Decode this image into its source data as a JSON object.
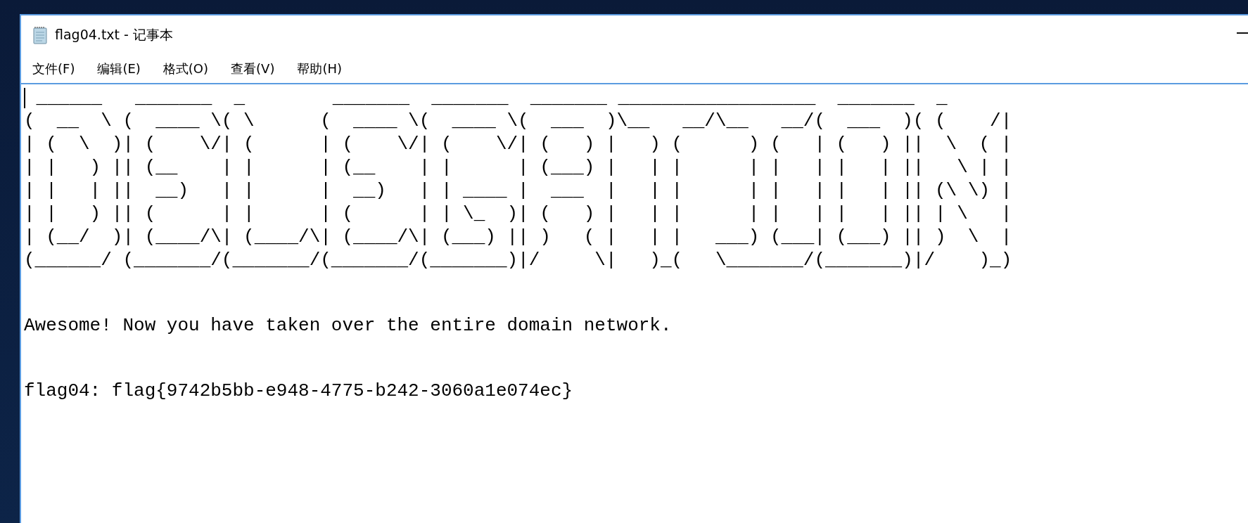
{
  "window": {
    "title": "flag04.txt - 记事本"
  },
  "menu": [
    "文件(F)",
    "编辑(E)",
    "格式(O)",
    "查看(V)",
    "帮助(H)"
  ],
  "editor": {
    "banner_lines": [
      " ______   _______  _        _______  _______  _______ __________________  _______  _",
      "(  __  \\ (  ____ \\( \\      (  ____ \\(  ____ \\(  ___  )\\__   __/\\__   __/(  ___  )( (    /|",
      "| (  \\  )| (    \\/| (      | (    \\/| (    \\/| (   ) |   ) (      ) (   | (   ) ||  \\  ( |",
      "| |   ) || (__    | |      | (__    | |      | (___) |   | |      | |   | |   | ||   \\ | |",
      "| |   | ||  __)   | |      |  __)   | | ____ |  ___  |   | |      | |   | |   | || (\\ \\) |",
      "| |   ) || (      | |      | (      | | \\_  )| (   ) |   | |      | |   | |   | || | \\   |",
      "| (__/  )| (____/\\| (____/\\| (____/\\| (___) || )   ( |   | |   ___) (___| (___) || )  \\  |",
      "(______/ (_______/(_______/(_______/(_______)|/     \\|   )_(   \\_______/(_______)|/    )_)"
    ],
    "paragraphs": [
      "Awesome! Now you have taken over the entire domain network.",
      "flag04: flag{9742b5bb-e948-4775-b242-3060a1e074ec}"
    ]
  }
}
